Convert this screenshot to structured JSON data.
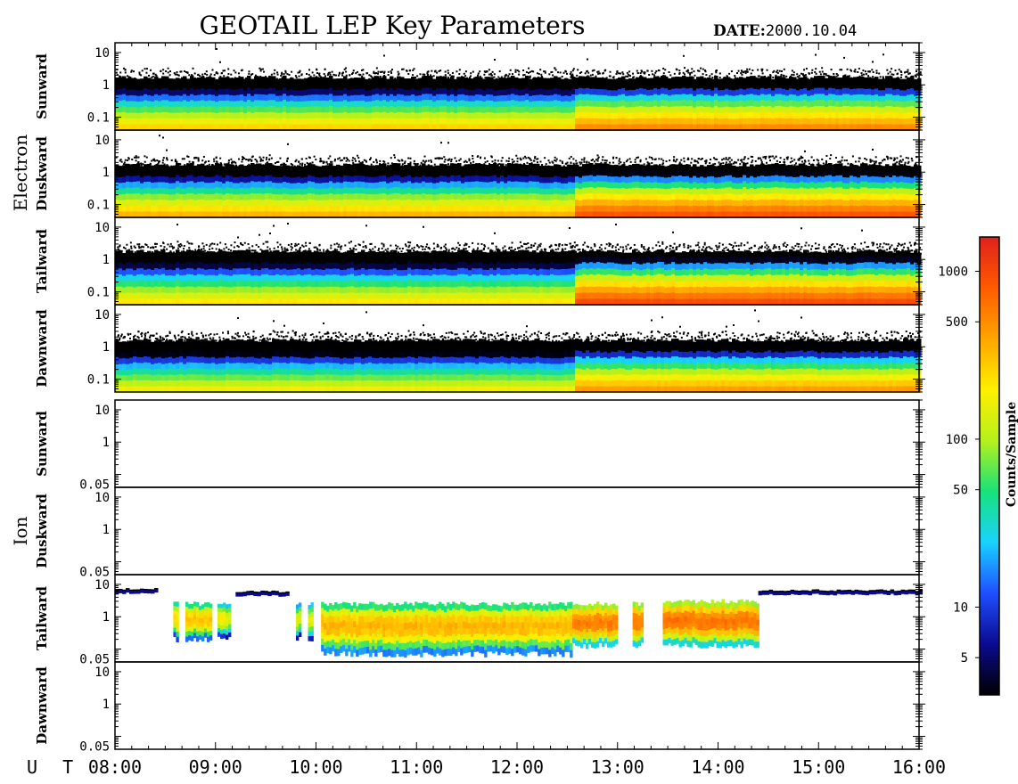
{
  "title": "GEOTAIL LEP Key Parameters",
  "date_label": "DATE:",
  "date_value": "2000.10.04",
  "ut_label": "U T",
  "colorbar": {
    "label": "Counts/Sample",
    "ticks": [
      "1000",
      "500",
      "100",
      "50",
      "10",
      "5"
    ],
    "tick_values": [
      1000,
      500,
      100,
      50,
      10,
      5
    ],
    "range": [
      3,
      1600
    ],
    "scale": "log",
    "colormap": [
      "#000000",
      "#0a0a90",
      "#1f4fff",
      "#19d2ff",
      "#18e27a",
      "#b5f01c",
      "#ffef00",
      "#ffa500",
      "#ff5a00",
      "#e0201b"
    ]
  },
  "groups": [
    {
      "name": "Electron",
      "panels": [
        "Sunward",
        "Duskward",
        "Tailward",
        "Dawnward"
      ]
    },
    {
      "name": "Ion",
      "panels": [
        "Sunward",
        "Duskward",
        "Tailward",
        "Dawnward"
      ]
    }
  ],
  "electron_yticks": [
    "10",
    "1",
    "0.1"
  ],
  "ion_yticks": [
    "10",
    "1",
    "0.05"
  ],
  "chart_data": {
    "type": "heatmap",
    "title": "GEOTAIL LEP Key Parameters",
    "date": "2000.10.04",
    "x_ticks": [
      "08:00",
      "09:00",
      "10:00",
      "11:00",
      "12:00",
      "13:00",
      "14:00",
      "15:00",
      "16:00"
    ],
    "x_range_hours": [
      8,
      16
    ],
    "electron_y_range": [
      0.04,
      20
    ],
    "ion_y_range": [
      0.04,
      20
    ],
    "y_scale": "log",
    "electron_panels": [
      {
        "name": "Sunward",
        "low_counts_before": 300,
        "low_counts_after": 600,
        "step_time": 12.55,
        "upper_edge": 1.7
      },
      {
        "name": "Duskward",
        "low_counts_before": 400,
        "low_counts_after": 1000,
        "step_time": 12.55,
        "upper_edge": 1.7
      },
      {
        "name": "Tailward",
        "low_counts_before": 250,
        "low_counts_after": 1100,
        "step_time": 12.55,
        "upper_edge": 1.8
      },
      {
        "name": "Dawnward",
        "low_counts_before": 200,
        "low_counts_after": 500,
        "step_time": 12.55,
        "upper_edge": 1.6
      }
    ],
    "ion_panels": [
      {
        "name": "Sunward",
        "segments": []
      },
      {
        "name": "Duskward",
        "segments": []
      },
      {
        "name": "Tailward",
        "segments": [
          {
            "t0": 8.0,
            "t1": 8.42,
            "kind": "line",
            "y": 6,
            "counts": 20
          },
          {
            "t0": 8.58,
            "t1": 8.62,
            "kind": "band",
            "ylo": 0.2,
            "yhi": 2.5,
            "counts": 250
          },
          {
            "t0": 8.7,
            "t1": 8.95,
            "kind": "band",
            "ylo": 0.2,
            "yhi": 2.5,
            "counts": 300
          },
          {
            "t0": 9.02,
            "t1": 9.08,
            "kind": "band",
            "ylo": 0.2,
            "yhi": 2.5,
            "counts": 200
          },
          {
            "t0": 9.1,
            "t1": 9.15,
            "kind": "band",
            "ylo": 0.2,
            "yhi": 2.5,
            "counts": 150
          },
          {
            "t0": 9.2,
            "t1": 9.72,
            "kind": "line",
            "y": 5,
            "counts": 15
          },
          {
            "t0": 9.8,
            "t1": 9.84,
            "kind": "band",
            "ylo": 0.2,
            "yhi": 2.5,
            "counts": 150
          },
          {
            "t0": 9.92,
            "t1": 9.96,
            "kind": "band",
            "ylo": 0.2,
            "yhi": 2.5,
            "counts": 150
          },
          {
            "t0": 10.05,
            "t1": 12.55,
            "kind": "band",
            "ylo": 0.07,
            "yhi": 2.5,
            "counts": 350
          },
          {
            "t0": 12.55,
            "t1": 13.0,
            "kind": "band",
            "ylo": 0.13,
            "yhi": 2.5,
            "counts": 600
          },
          {
            "t0": 13.15,
            "t1": 13.25,
            "kind": "band",
            "ylo": 0.13,
            "yhi": 2.5,
            "counts": 600
          },
          {
            "t0": 13.45,
            "t1": 14.4,
            "kind": "band",
            "ylo": 0.13,
            "yhi": 3.0,
            "counts": 650
          },
          {
            "t0": 14.4,
            "t1": 16.0,
            "kind": "line",
            "y": 5.5,
            "counts": 20
          }
        ]
      },
      {
        "name": "Dawnward",
        "segments": []
      }
    ]
  }
}
